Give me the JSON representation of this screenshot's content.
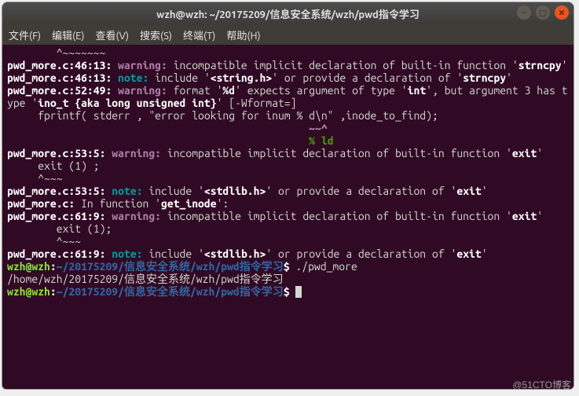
{
  "window": {
    "title": "wzh@wzh: ~/20175209/信息安全系统/wzh/pwd指令学习"
  },
  "menubar": {
    "file": "文件(F)",
    "edit": "编辑(E)",
    "view": "查看(V)",
    "search": "搜索(S)",
    "term": "终端(T)",
    "help": "帮助(H)"
  },
  "btn": {
    "min": "–",
    "max": "◻",
    "close": "✕"
  },
  "t": {
    "caret": "        ^~~~~~~~",
    "l1a": "pwd_more.c:46:13:",
    "l1w": " warning: ",
    "l1b": "incompatible implicit declaration of built-in function '",
    "l1c": "strncpy",
    "l1d": "'",
    "l2a": "pwd_more.c:46:13:",
    "l2n": " note: ",
    "l2b": "include '",
    "l2c": "<string.h>",
    "l2d": "' or provide a declaration of '",
    "l2e": "strncpy",
    "l2f": "'",
    "l3a": "pwd_more.c:52:49:",
    "l3w": " warning: ",
    "l3b": "format '",
    "l3c": "%d",
    "l3d": "' expects argument of type '",
    "l3e": "int",
    "l3f": "', but argument 3 has type '",
    "l3g": "ino_t {aka long unsigned int}",
    "l3h": "' [-Wformat=]",
    "l4": "     fprintf( stderr , \"error looking for inum % d\\n\" ,inode_to_find);",
    "l5": "                                                 ~~^",
    "l6": "                                                 % ld",
    "l7a": "pwd_more.c:53:5:",
    "l7w": " warning: ",
    "l7b": "incompatible implicit declaration of built-in function '",
    "l7c": "exit",
    "l7d": "'",
    "l8": "     exit (1) ;",
    "l9": "     ^~~~",
    "l10a": "pwd_more.c:53:5:",
    "l10n": " note: ",
    "l10b": "include '",
    "l10c": "<stdlib.h>",
    "l10d": "' or provide a declaration of '",
    "l10e": "exit",
    "l10f": "'",
    "l11a": "pwd_more.c:",
    "l11b": " In function '",
    "l11c": "get_inode",
    "l11d": "':",
    "l12a": "pwd_more.c:61:9:",
    "l12w": " warning: ",
    "l12b": "incompatible implicit declaration of built-in function '",
    "l12c": "exit",
    "l12d": "'",
    "l13": "        exit (1);",
    "l14": "        ^~~~",
    "l15a": "pwd_more.c:61:9:",
    "l15n": " note: ",
    "l15b": "include '",
    "l15c": "<stdlib.h>",
    "l15d": "' or provide a declaration of '",
    "l15e": "exit",
    "l15f": "'",
    "p_user": "wzh@wzh",
    "p_colon": ":",
    "p_path": "~/20175209/信息安全系统/wzh/pwd指令学习",
    "p_dollar": "$ ",
    "cmd1": "./pwd_more",
    "out": "/home/wzh/20175209/信息安全系统/wzh/pwd指令学习"
  },
  "watermark": "@51CTO博客"
}
